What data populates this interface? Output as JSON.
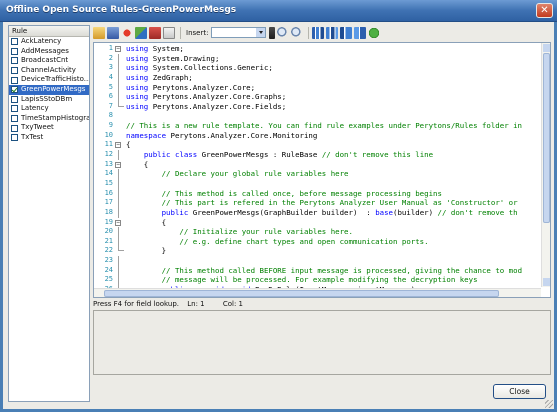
{
  "window": {
    "title": "Offline Open Source Rules-GreenPowerMesgs",
    "close_glyph": "✕"
  },
  "rules": {
    "header": "Rule",
    "items": [
      {
        "label": "AckLatency",
        "checked": false,
        "selected": false
      },
      {
        "label": "AddMessages",
        "checked": false,
        "selected": false
      },
      {
        "label": "BroadcastCnt",
        "checked": false,
        "selected": false
      },
      {
        "label": "ChannelActivity",
        "checked": false,
        "selected": false
      },
      {
        "label": "DeviceTrafficHisto...",
        "checked": false,
        "selected": false
      },
      {
        "label": "GreenPowerMesgs",
        "checked": true,
        "selected": true
      },
      {
        "label": "LapisSStoDBm",
        "checked": false,
        "selected": false
      },
      {
        "label": "Latency",
        "checked": false,
        "selected": false
      },
      {
        "label": "TimeStampHistogram",
        "checked": false,
        "selected": false
      },
      {
        "label": "TxyTweet",
        "checked": false,
        "selected": false
      },
      {
        "label": "TxTest",
        "checked": false,
        "selected": false
      }
    ]
  },
  "toolbar": {
    "insert_label": "Insert:",
    "insert_value": ""
  },
  "editor": {
    "lines": [
      {
        "n": "1",
        "fold": "minus",
        "parts": [
          {
            "c": "kw",
            "t": "using"
          },
          {
            "c": "tx",
            "t": " System;"
          }
        ]
      },
      {
        "n": "2",
        "fold": "line",
        "parts": [
          {
            "c": "kw",
            "t": "using"
          },
          {
            "c": "tx",
            "t": " System.Drawing;"
          }
        ]
      },
      {
        "n": "3",
        "fold": "line",
        "parts": [
          {
            "c": "kw",
            "t": "using"
          },
          {
            "c": "tx",
            "t": " System.Collections.Generic;"
          }
        ]
      },
      {
        "n": "4",
        "fold": "line",
        "parts": [
          {
            "c": "kw",
            "t": "using"
          },
          {
            "c": "tx",
            "t": " ZedGraph;"
          }
        ]
      },
      {
        "n": "5",
        "fold": "line",
        "parts": [
          {
            "c": "kw",
            "t": "using"
          },
          {
            "c": "tx",
            "t": " Perytons.Analyzer.Core;"
          }
        ]
      },
      {
        "n": "6",
        "fold": "line",
        "parts": [
          {
            "c": "kw",
            "t": "using"
          },
          {
            "c": "tx",
            "t": " Perytons.Analyzer.Core.Graphs;"
          }
        ]
      },
      {
        "n": "7",
        "fold": "end",
        "parts": [
          {
            "c": "kw",
            "t": "using"
          },
          {
            "c": "tx",
            "t": " Perytons.Analyzer.Core.Fields;"
          }
        ]
      },
      {
        "n": "8",
        "fold": "",
        "parts": []
      },
      {
        "n": "9",
        "fold": "",
        "parts": [
          {
            "c": "cm",
            "t": "// This is a new rule template. You can find rule examples under Perytons/Rules folder in"
          }
        ]
      },
      {
        "n": "10",
        "fold": "",
        "parts": [
          {
            "c": "kw",
            "t": "namespace"
          },
          {
            "c": "tx",
            "t": " Perytons.Analyzer.Core.Monitoring"
          }
        ]
      },
      {
        "n": "11",
        "fold": "minus",
        "parts": [
          {
            "c": "tx",
            "t": "{"
          }
        ]
      },
      {
        "n": "12",
        "fold": "line",
        "parts": [
          {
            "c": "tx",
            "t": "    "
          },
          {
            "c": "kw",
            "t": "public class"
          },
          {
            "c": "tx",
            "t": " GreenPowerMesgs : RuleBase "
          },
          {
            "c": "cm",
            "t": "// don't remove this line"
          }
        ]
      },
      {
        "n": "13",
        "fold": "minus",
        "parts": [
          {
            "c": "tx",
            "t": "    {"
          }
        ]
      },
      {
        "n": "14",
        "fold": "line",
        "parts": [
          {
            "c": "tx",
            "t": "        "
          },
          {
            "c": "cm",
            "t": "// Declare your global rule variables here"
          }
        ]
      },
      {
        "n": "15",
        "fold": "line",
        "parts": []
      },
      {
        "n": "16",
        "fold": "line",
        "parts": [
          {
            "c": "tx",
            "t": "        "
          },
          {
            "c": "cm",
            "t": "// This method is called once, before message processing begins"
          }
        ]
      },
      {
        "n": "17",
        "fold": "line",
        "parts": [
          {
            "c": "tx",
            "t": "        "
          },
          {
            "c": "cm",
            "t": "// This part is refered in the Perytons Analyzer User Manual as 'Constructor' or"
          }
        ]
      },
      {
        "n": "18",
        "fold": "line",
        "parts": [
          {
            "c": "tx",
            "t": "        "
          },
          {
            "c": "kw",
            "t": "public"
          },
          {
            "c": "tx",
            "t": " GreenPowerMesgs(GraphBuilder builder)  : "
          },
          {
            "c": "kw",
            "t": "base"
          },
          {
            "c": "tx",
            "t": "(builder) "
          },
          {
            "c": "cm",
            "t": "// don't remove th"
          }
        ]
      },
      {
        "n": "19",
        "fold": "minus",
        "parts": [
          {
            "c": "tx",
            "t": "        {"
          }
        ]
      },
      {
        "n": "20",
        "fold": "line",
        "parts": [
          {
            "c": "tx",
            "t": "            "
          },
          {
            "c": "cm",
            "t": "// Initialize your rule variables here."
          }
        ]
      },
      {
        "n": "21",
        "fold": "line",
        "parts": [
          {
            "c": "tx",
            "t": "            "
          },
          {
            "c": "cm",
            "t": "// e.g. define chart types and open communication ports."
          }
        ]
      },
      {
        "n": "22",
        "fold": "end",
        "parts": [
          {
            "c": "tx",
            "t": "        }"
          }
        ]
      },
      {
        "n": "23",
        "fold": "line",
        "parts": []
      },
      {
        "n": "24",
        "fold": "line",
        "parts": [
          {
            "c": "tx",
            "t": "        "
          },
          {
            "c": "cm",
            "t": "// This method called BEFORE input message is processed, giving the chance to mod"
          }
        ]
      },
      {
        "n": "25",
        "fold": "line",
        "parts": [
          {
            "c": "tx",
            "t": "        "
          },
          {
            "c": "cm",
            "t": "// message will be processed. For example modifying the decryption keys"
          }
        ]
      },
      {
        "n": "26",
        "fold": "line",
        "parts": [
          {
            "c": "tx",
            "t": "        "
          },
          {
            "c": "kw",
            "t": "public override void"
          },
          {
            "c": "tx",
            "t": " PreDoRule(InputMessage inputMessage)"
          }
        ]
      },
      {
        "n": "27",
        "fold": "minus",
        "parts": [
          {
            "c": "tx",
            "t": "        {"
          }
        ]
      },
      {
        "n": "28",
        "fold": "line",
        "parts": [
          {
            "c": "tx",
            "t": "            "
          },
          {
            "c": "cm",
            "t": "//Perytons.Analyzer.Core.Encryption.NetworkKey key = Plugins[Protocol].Plugin"
          }
        ]
      }
    ]
  },
  "status": {
    "hint": "Press F4 for field lookup.",
    "line": "Ln: 1",
    "col": "Col: 1"
  },
  "footer": {
    "close_label": "Close"
  }
}
